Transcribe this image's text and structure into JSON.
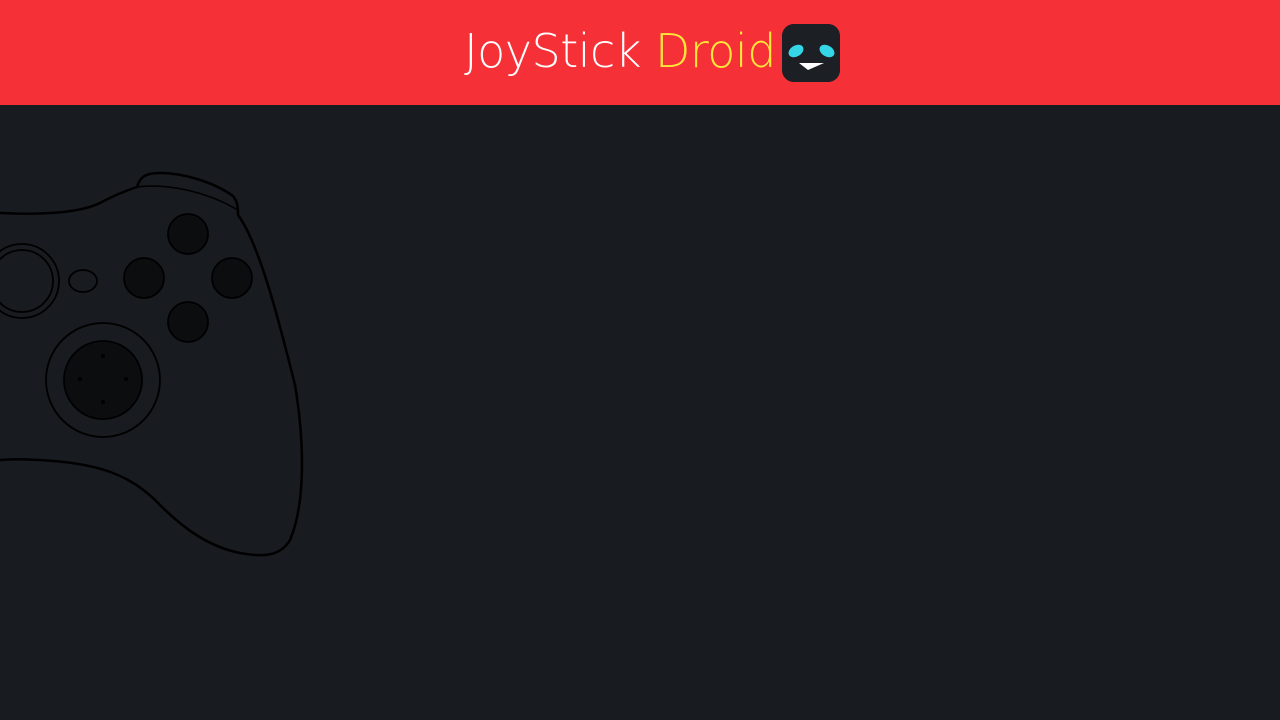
{
  "header": {
    "title_part1": "JoyStick",
    "title_part2": "Droid",
    "background_color": "#f63037",
    "title_part1_color": "#ffffff",
    "title_part2_color": "#ffe83a",
    "app_icon": "robot-face-icon"
  },
  "main": {
    "background_color": "#181b1f",
    "illustration": "gamepad-icon"
  }
}
